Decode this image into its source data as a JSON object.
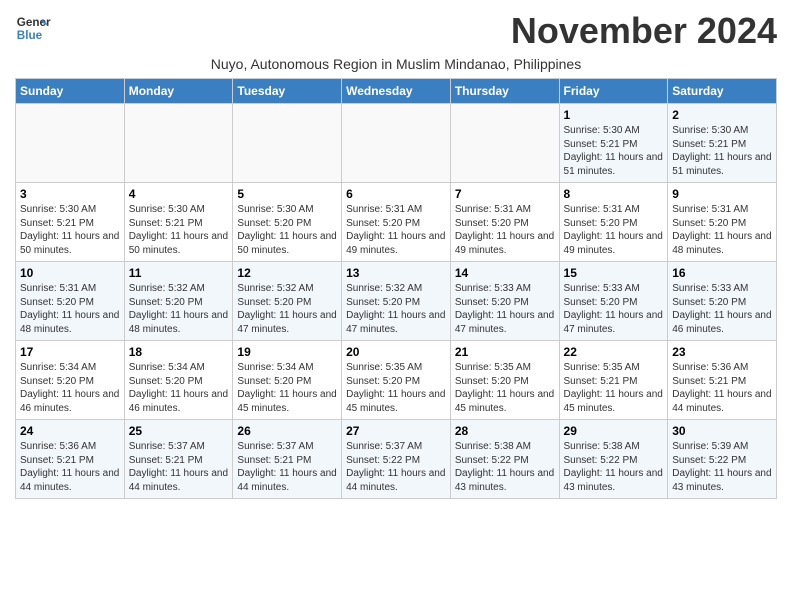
{
  "header": {
    "logo_line1": "General",
    "logo_line2": "Blue",
    "month_title": "November 2024",
    "subtitle": "Nuyo, Autonomous Region in Muslim Mindanao, Philippines"
  },
  "weekdays": [
    "Sunday",
    "Monday",
    "Tuesday",
    "Wednesday",
    "Thursday",
    "Friday",
    "Saturday"
  ],
  "weeks": [
    [
      {
        "day": "",
        "info": ""
      },
      {
        "day": "",
        "info": ""
      },
      {
        "day": "",
        "info": ""
      },
      {
        "day": "",
        "info": ""
      },
      {
        "day": "",
        "info": ""
      },
      {
        "day": "1",
        "info": "Sunrise: 5:30 AM\nSunset: 5:21 PM\nDaylight: 11 hours and 51 minutes."
      },
      {
        "day": "2",
        "info": "Sunrise: 5:30 AM\nSunset: 5:21 PM\nDaylight: 11 hours and 51 minutes."
      }
    ],
    [
      {
        "day": "3",
        "info": "Sunrise: 5:30 AM\nSunset: 5:21 PM\nDaylight: 11 hours and 50 minutes."
      },
      {
        "day": "4",
        "info": "Sunrise: 5:30 AM\nSunset: 5:21 PM\nDaylight: 11 hours and 50 minutes."
      },
      {
        "day": "5",
        "info": "Sunrise: 5:30 AM\nSunset: 5:20 PM\nDaylight: 11 hours and 50 minutes."
      },
      {
        "day": "6",
        "info": "Sunrise: 5:31 AM\nSunset: 5:20 PM\nDaylight: 11 hours and 49 minutes."
      },
      {
        "day": "7",
        "info": "Sunrise: 5:31 AM\nSunset: 5:20 PM\nDaylight: 11 hours and 49 minutes."
      },
      {
        "day": "8",
        "info": "Sunrise: 5:31 AM\nSunset: 5:20 PM\nDaylight: 11 hours and 49 minutes."
      },
      {
        "day": "9",
        "info": "Sunrise: 5:31 AM\nSunset: 5:20 PM\nDaylight: 11 hours and 48 minutes."
      }
    ],
    [
      {
        "day": "10",
        "info": "Sunrise: 5:31 AM\nSunset: 5:20 PM\nDaylight: 11 hours and 48 minutes."
      },
      {
        "day": "11",
        "info": "Sunrise: 5:32 AM\nSunset: 5:20 PM\nDaylight: 11 hours and 48 minutes."
      },
      {
        "day": "12",
        "info": "Sunrise: 5:32 AM\nSunset: 5:20 PM\nDaylight: 11 hours and 47 minutes."
      },
      {
        "day": "13",
        "info": "Sunrise: 5:32 AM\nSunset: 5:20 PM\nDaylight: 11 hours and 47 minutes."
      },
      {
        "day": "14",
        "info": "Sunrise: 5:33 AM\nSunset: 5:20 PM\nDaylight: 11 hours and 47 minutes."
      },
      {
        "day": "15",
        "info": "Sunrise: 5:33 AM\nSunset: 5:20 PM\nDaylight: 11 hours and 47 minutes."
      },
      {
        "day": "16",
        "info": "Sunrise: 5:33 AM\nSunset: 5:20 PM\nDaylight: 11 hours and 46 minutes."
      }
    ],
    [
      {
        "day": "17",
        "info": "Sunrise: 5:34 AM\nSunset: 5:20 PM\nDaylight: 11 hours and 46 minutes."
      },
      {
        "day": "18",
        "info": "Sunrise: 5:34 AM\nSunset: 5:20 PM\nDaylight: 11 hours and 46 minutes."
      },
      {
        "day": "19",
        "info": "Sunrise: 5:34 AM\nSunset: 5:20 PM\nDaylight: 11 hours and 45 minutes."
      },
      {
        "day": "20",
        "info": "Sunrise: 5:35 AM\nSunset: 5:20 PM\nDaylight: 11 hours and 45 minutes."
      },
      {
        "day": "21",
        "info": "Sunrise: 5:35 AM\nSunset: 5:20 PM\nDaylight: 11 hours and 45 minutes."
      },
      {
        "day": "22",
        "info": "Sunrise: 5:35 AM\nSunset: 5:21 PM\nDaylight: 11 hours and 45 minutes."
      },
      {
        "day": "23",
        "info": "Sunrise: 5:36 AM\nSunset: 5:21 PM\nDaylight: 11 hours and 44 minutes."
      }
    ],
    [
      {
        "day": "24",
        "info": "Sunrise: 5:36 AM\nSunset: 5:21 PM\nDaylight: 11 hours and 44 minutes."
      },
      {
        "day": "25",
        "info": "Sunrise: 5:37 AM\nSunset: 5:21 PM\nDaylight: 11 hours and 44 minutes."
      },
      {
        "day": "26",
        "info": "Sunrise: 5:37 AM\nSunset: 5:21 PM\nDaylight: 11 hours and 44 minutes."
      },
      {
        "day": "27",
        "info": "Sunrise: 5:37 AM\nSunset: 5:22 PM\nDaylight: 11 hours and 44 minutes."
      },
      {
        "day": "28",
        "info": "Sunrise: 5:38 AM\nSunset: 5:22 PM\nDaylight: 11 hours and 43 minutes."
      },
      {
        "day": "29",
        "info": "Sunrise: 5:38 AM\nSunset: 5:22 PM\nDaylight: 11 hours and 43 minutes."
      },
      {
        "day": "30",
        "info": "Sunrise: 5:39 AM\nSunset: 5:22 PM\nDaylight: 11 hours and 43 minutes."
      }
    ]
  ]
}
